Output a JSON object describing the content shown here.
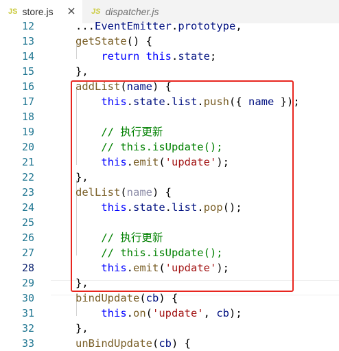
{
  "tabs": [
    {
      "badge": "JS",
      "label": "store.js",
      "active": true
    },
    {
      "badge": "JS",
      "label": "dispatcher.js",
      "active": false
    }
  ],
  "icons": {
    "close": "close-icon"
  },
  "current_line": "28",
  "colors": {
    "highlight_box": "#e8251e",
    "keyword": "#0000ff",
    "comment": "#008000",
    "string": "#a31515"
  },
  "lines": [
    {
      "num": "12",
      "text": "...EventEmitter.prototype,"
    },
    {
      "num": "13",
      "text": "getState() {"
    },
    {
      "num": "14",
      "text": "    return this.state;"
    },
    {
      "num": "15",
      "text": "},"
    },
    {
      "num": "16",
      "text": "addList(name) {"
    },
    {
      "num": "17",
      "text": "    this.state.list.push({ name });"
    },
    {
      "num": "18",
      "text": ""
    },
    {
      "num": "19",
      "text": "    // 执行更新"
    },
    {
      "num": "20",
      "text": "    // this.isUpdate();"
    },
    {
      "num": "21",
      "text": "    this.emit('update');"
    },
    {
      "num": "22",
      "text": "},"
    },
    {
      "num": "23",
      "text": "delList(name) {"
    },
    {
      "num": "24",
      "text": "    this.state.list.pop();"
    },
    {
      "num": "25",
      "text": ""
    },
    {
      "num": "26",
      "text": "    // 执行更新"
    },
    {
      "num": "27",
      "text": "    // this.isUpdate();"
    },
    {
      "num": "28",
      "text": "    this.emit('update');"
    },
    {
      "num": "29",
      "text": "},"
    },
    {
      "num": "30",
      "text": "bindUpdate(cb) {"
    },
    {
      "num": "31",
      "text": "    this.on('update', cb);"
    },
    {
      "num": "32",
      "text": "},"
    },
    {
      "num": "33",
      "text": "unBindUpdate(cb) {"
    }
  ]
}
